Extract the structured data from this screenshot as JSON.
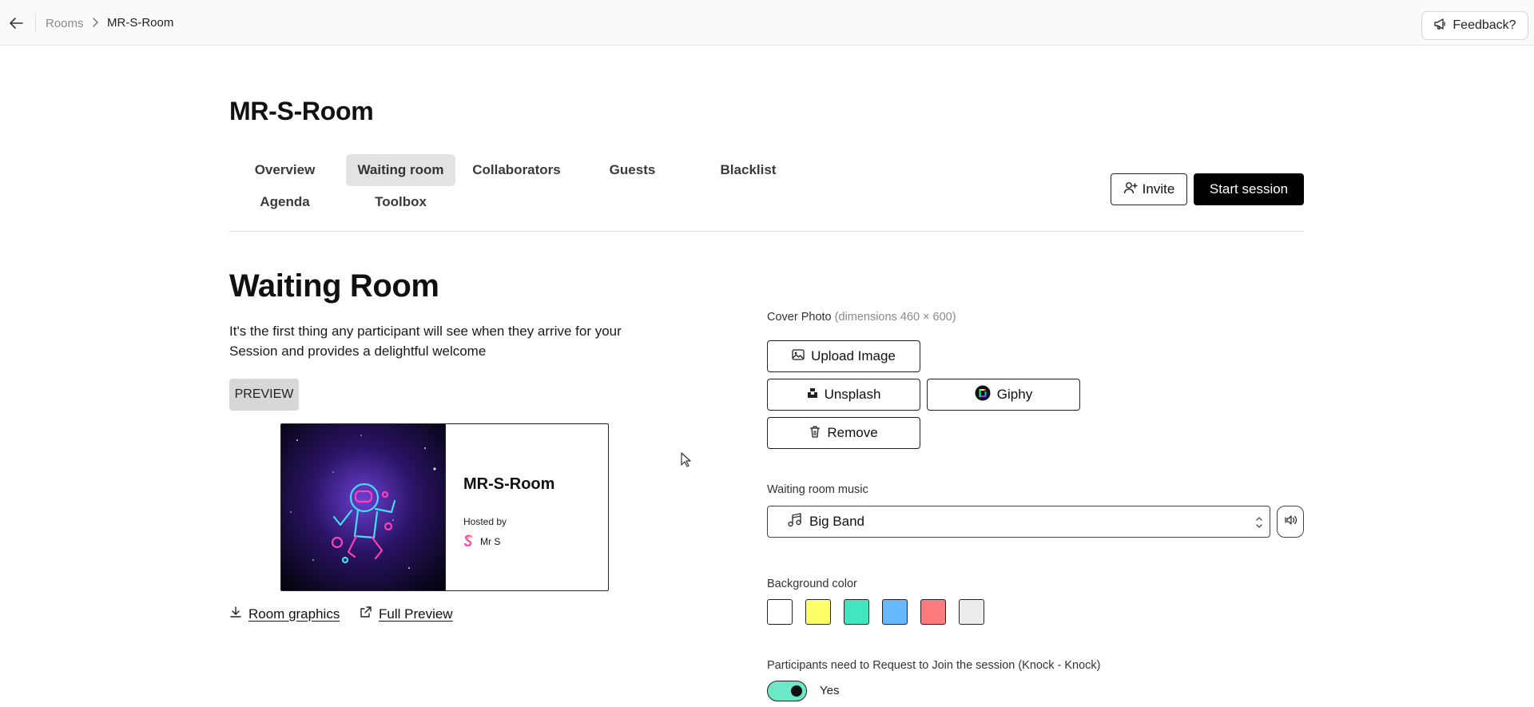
{
  "breadcrumb": {
    "rooms": "Rooms",
    "current": "MR-S-Room"
  },
  "feedback": {
    "label": "Feedback?"
  },
  "room": {
    "title": "MR-S-Room"
  },
  "tabs": {
    "overview": "Overview",
    "waiting_room": "Waiting room",
    "collaborators": "Collaborators",
    "guests": "Guests",
    "blacklist": "Blacklist",
    "agenda": "Agenda",
    "toolbox": "Toolbox",
    "active": "waiting_room"
  },
  "actions": {
    "invite": "Invite",
    "start_session": "Start session"
  },
  "waiting_room": {
    "title": "Waiting Room",
    "description": "It's the first thing any participant will see when they arrive for your Session and provides a delightful welcome",
    "preview_label": "PREVIEW",
    "card": {
      "title": "MR-S-Room",
      "hosted_by": "Hosted by",
      "host_name": "Mr S"
    },
    "links": {
      "room_graphics": "Room graphics",
      "full_preview": "Full Preview"
    }
  },
  "cover_photo": {
    "label": "Cover Photo",
    "hint": "(dimensions 460 × 600)",
    "upload": "Upload Image",
    "unsplash": "Unsplash",
    "giphy": "Giphy",
    "remove": "Remove"
  },
  "music": {
    "label": "Waiting room music",
    "selected": "Big Band"
  },
  "background": {
    "label": "Background color",
    "colors": [
      "#ffffff",
      "#ffff66",
      "#40e6c0",
      "#66b8ff",
      "#ff7a7a",
      "#ececec"
    ]
  },
  "knock": {
    "label": "Participants need to Request to Join the session (Knock - Knock)",
    "value_label": "Yes",
    "enabled": true
  },
  "accent_color": "#6ce8c7"
}
